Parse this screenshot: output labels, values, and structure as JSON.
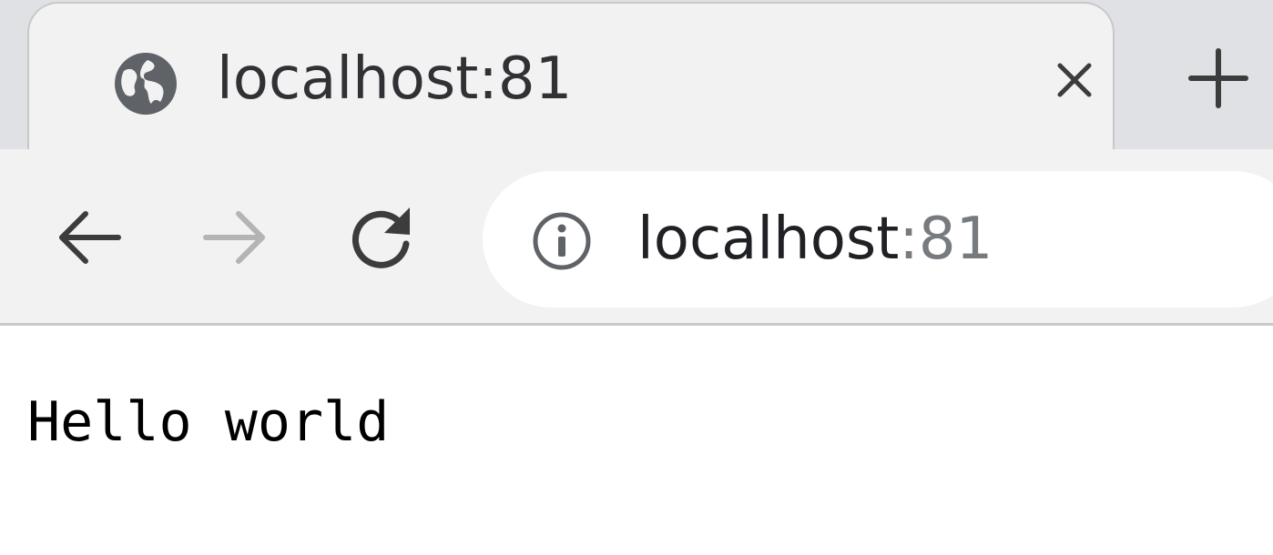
{
  "tab": {
    "title": "localhost:81",
    "favicon": "globe-icon",
    "close_icon": "close-icon"
  },
  "new_tab": {
    "icon": "plus-icon"
  },
  "toolbar": {
    "back_icon": "arrow-left-icon",
    "forward_icon": "arrow-right-icon",
    "forward_enabled": false,
    "reload_icon": "reload-icon",
    "site_info_icon": "info-icon"
  },
  "address_bar": {
    "host": "localhost",
    "port": ":81"
  },
  "page": {
    "text": "Hello world"
  },
  "colors": {
    "tabstrip_bg": "#dfe1e5",
    "active_tab_bg": "#f2f2f2",
    "icon_color": "#3c3c3c",
    "disabled_icon_color": "#b4b4b4",
    "url_port_color": "#777a7e"
  }
}
